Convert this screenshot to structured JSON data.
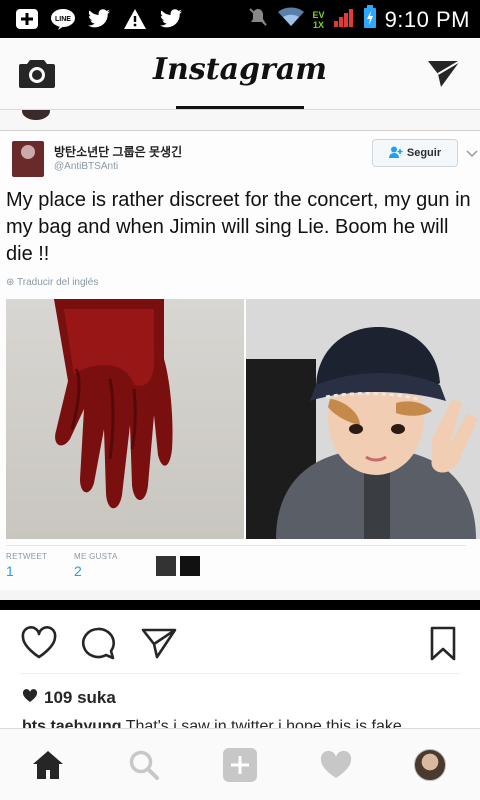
{
  "status_bar": {
    "time": "9:10 PM",
    "network_label": "EV",
    "icons": [
      "plus-icon",
      "line-icon",
      "twitter-icon",
      "warning-icon",
      "twitter-icon",
      "mute-icon",
      "wifi-icon",
      "signal-icon",
      "battery-icon"
    ]
  },
  "header": {
    "logo": "Instagram",
    "left_icon": "camera-icon",
    "right_icon": "direct-message-icon"
  },
  "tweet": {
    "display_name": "방탄소년단 그룹은 못생긴",
    "handle": "@AntiBTSAnti",
    "follow_label": "Seguir",
    "text": "My place is rather discreet for the concert, my gun in my bag and when Jimin will sing Lie. Boom he will die !!",
    "translate_label": "Traducir del inglés",
    "retweet_label": "RETWEET",
    "retweet_count": "1",
    "like_label": "ME GUSTA",
    "like_count": "2"
  },
  "post": {
    "likes": "109 suka",
    "caption_user": "bts.taehyung",
    "caption_text": "That's i saw in twitter i hope this is fake"
  },
  "colors": {
    "twitter_blue": "#1da1f2",
    "ig_text": "#262626",
    "icon_gray": "#262626",
    "nav_inactive": "#c7c7c7"
  },
  "bottom_nav": {
    "items": [
      "home-icon",
      "search-icon",
      "add-post-icon",
      "activity-heart-icon",
      "profile-avatar"
    ]
  }
}
